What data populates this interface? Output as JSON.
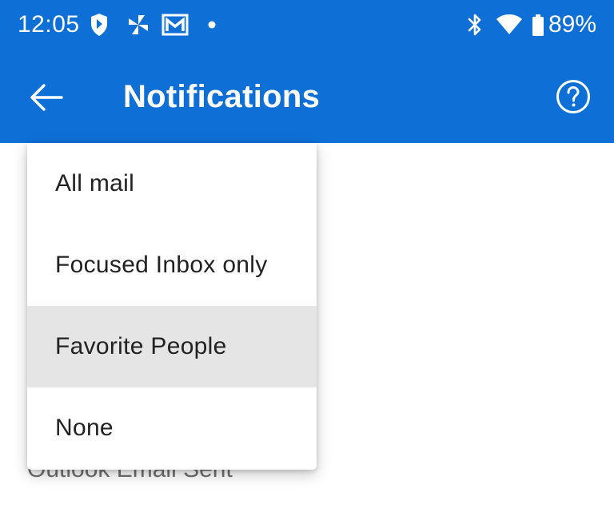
{
  "status_bar": {
    "time": "12:05",
    "battery_percent": "89%",
    "icons_left": [
      "shield-icon",
      "pinwheel-icon",
      "gmail-icon",
      "notification-dot-icon"
    ],
    "icons_right": [
      "bluetooth-icon",
      "wifi-icon",
      "battery-icon"
    ]
  },
  "app_bar": {
    "title": "Notifications",
    "back_icon": "back-arrow-icon",
    "help_icon": "help-icon",
    "background_color": "#0e6fd6"
  },
  "dropdown": {
    "options": [
      {
        "label": "All mail",
        "selected": false
      },
      {
        "label": "Focused Inbox only",
        "selected": false
      },
      {
        "label": "Favorite People",
        "selected": true
      },
      {
        "label": "None",
        "selected": false
      }
    ],
    "selected_background": "#e5e5e5"
  },
  "underlying": {
    "partially_visible_label": "Outlook Email Sent"
  }
}
